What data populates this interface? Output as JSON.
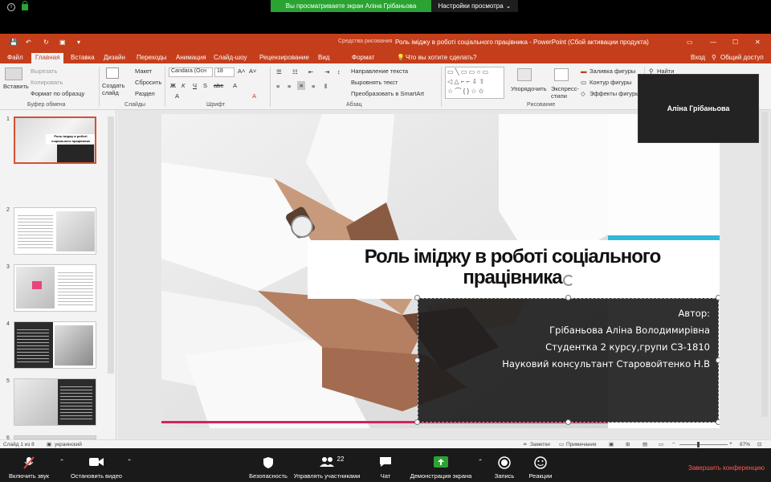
{
  "zoom_top": {
    "share_banner": "Вы просматриваете экран Аліна Грібаньова",
    "view_options": "Настройки просмотра"
  },
  "ppt": {
    "title": "Роль іміджу в роботі соціального працівника - PowerPoint (Сбой активации продукта)",
    "drawing_tools": "Средства рисования",
    "login": "Вход",
    "share": "Общий доступ",
    "tabs": [
      "Файл",
      "Главная",
      "Вставка",
      "Дизайн",
      "Переходы",
      "Анимация",
      "Слайд-шоу",
      "Рецензирование",
      "Вид",
      "Формат"
    ],
    "tell_me": "Что вы хотите сделать?",
    "ribbon": {
      "paste": "Вставить",
      "cut": "Вырезать",
      "copy": "Копировать",
      "format_painter": "Формат по образцу",
      "clipboard": "Буфер обмена",
      "new_slide": "Создать слайд",
      "layout": "Макет",
      "reset": "Сбросить",
      "section": "Раздел",
      "slides": "Слайды",
      "font_name": "Candara (Осн",
      "font_size": "18",
      "font": "Шрифт",
      "bold": "Ж",
      "italic": "К",
      "underline": "Ч",
      "strike": "S",
      "shadow": "abc",
      "text_direction": "Направление текста",
      "align_text": "Выровнять текст",
      "smartart": "Преобразовать в SmartArt",
      "paragraph": "Абзац",
      "arrange": "Упорядочить",
      "quick_styles": "Экспресс-стили",
      "drawing": "Рисование",
      "shape_fill": "Заливка фигуры",
      "shape_outline": "Контур фигуры",
      "shape_effects": "Эффекты фигуры",
      "find": "Найти"
    },
    "slide": {
      "title": "Роль іміджу в роботі соціального працівника",
      "author_label": "Автор:",
      "author_name": "Грібаньова Аліна Володимирівна",
      "student": "Студентка 2 курсу,групи СЗ-1810",
      "advisor": "Науковий консультант Старовойтенко Н.В"
    },
    "thumbnails": [
      "1",
      "2",
      "3",
      "4",
      "5",
      "6"
    ],
    "thumb1_title": "Роль іміджу в роботі соціального працівника",
    "status": {
      "slide": "Слайд 1 из 8",
      "language": "украинский",
      "notes": "Заметки",
      "comments": "Примечания",
      "zoom": "87%"
    }
  },
  "participant": "Аліна Грібаньова",
  "zoom_bottom": {
    "mute": "Включить звук",
    "video": "Остановить видео",
    "security": "Безопасность",
    "participants": "Управлять участниками",
    "participants_count": "22",
    "chat": "Чат",
    "share": "Демонстрация экрана",
    "record": "Запись",
    "reactions": "Реакции",
    "end": "Завершить конференцию"
  }
}
